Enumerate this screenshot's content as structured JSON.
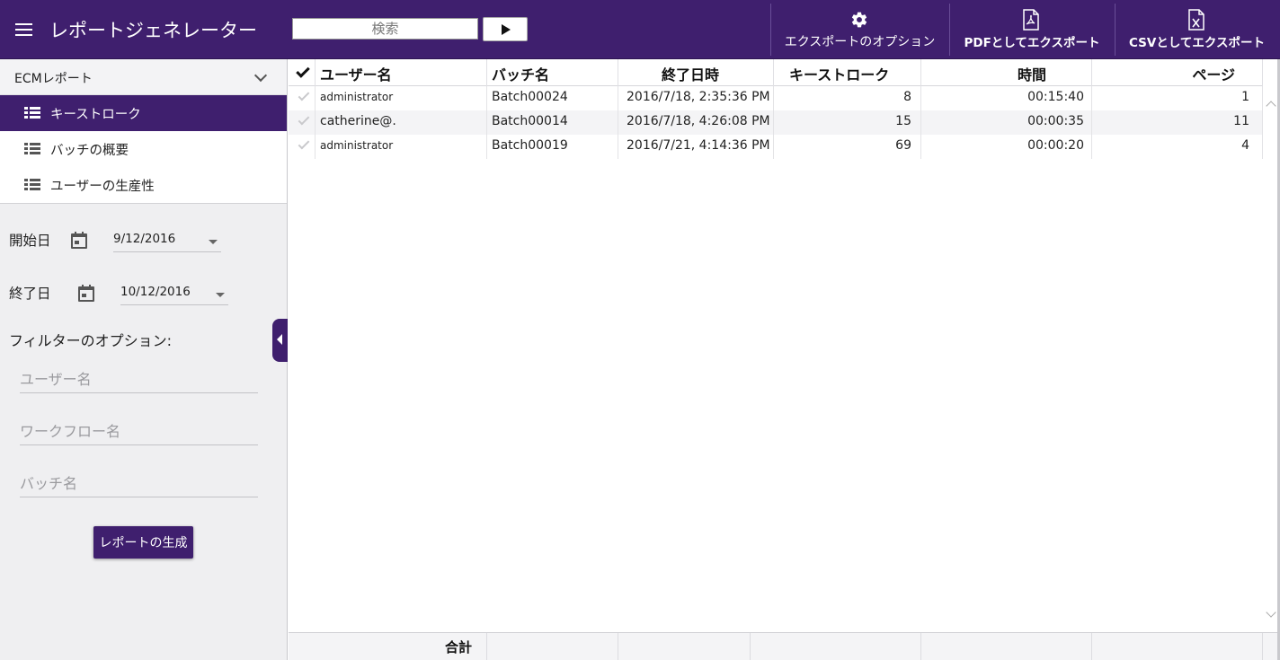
{
  "header": {
    "title": "レポートジェネレーター",
    "search_placeholder": "検索",
    "export_options_label": "エクスポートのオプション",
    "export_pdf_label": "PDFとしてエクスポート",
    "export_csv_label": "CSVとしてエクスポート",
    "colors": {
      "primary": "#3f1f6e",
      "text_on_primary": "#ffffff"
    }
  },
  "sidebar": {
    "group_label": "ECMレポート",
    "items": [
      {
        "label": "キーストローク",
        "active": true,
        "icon": "list-icon"
      },
      {
        "label": "バッチの概要",
        "active": false,
        "icon": "list-icon"
      },
      {
        "label": "ユーザーの生産性",
        "active": false,
        "icon": "list-icon"
      }
    ],
    "start_label": "開始日",
    "start_value": "9/12/2016",
    "end_label": "終了日",
    "end_value": "10/12/2016",
    "filter_heading": "フィルターのオプション:",
    "filters": {
      "user_placeholder": "ユーザー名",
      "workflow_placeholder": "ワークフロー名",
      "batch_placeholder": "バッチ名"
    },
    "generate_label": "レポートの生成"
  },
  "grid": {
    "columns": [
      "ユーザー名",
      "バッチ名",
      "終了日時",
      "キーストローク",
      "時間",
      "ページ"
    ],
    "rows": [
      {
        "user": "administrator",
        "batch": "Batch00024",
        "end": "2016/7/18, 2:35:36 PM",
        "keystrokes": "8",
        "time": "00:15:40",
        "pages": "1"
      },
      {
        "user": "catherine@.",
        "batch": "Batch00014",
        "end": "2016/7/18, 4:26:08 PM",
        "keystrokes": "15",
        "time": "00:00:35",
        "pages": "11"
      },
      {
        "user": "administrator",
        "batch": "Batch00019",
        "end": "2016/7/21, 4:14:36 PM",
        "keystrokes": "69",
        "time": "00:00:20",
        "pages": "4"
      }
    ],
    "footer_total_label": "合計"
  }
}
